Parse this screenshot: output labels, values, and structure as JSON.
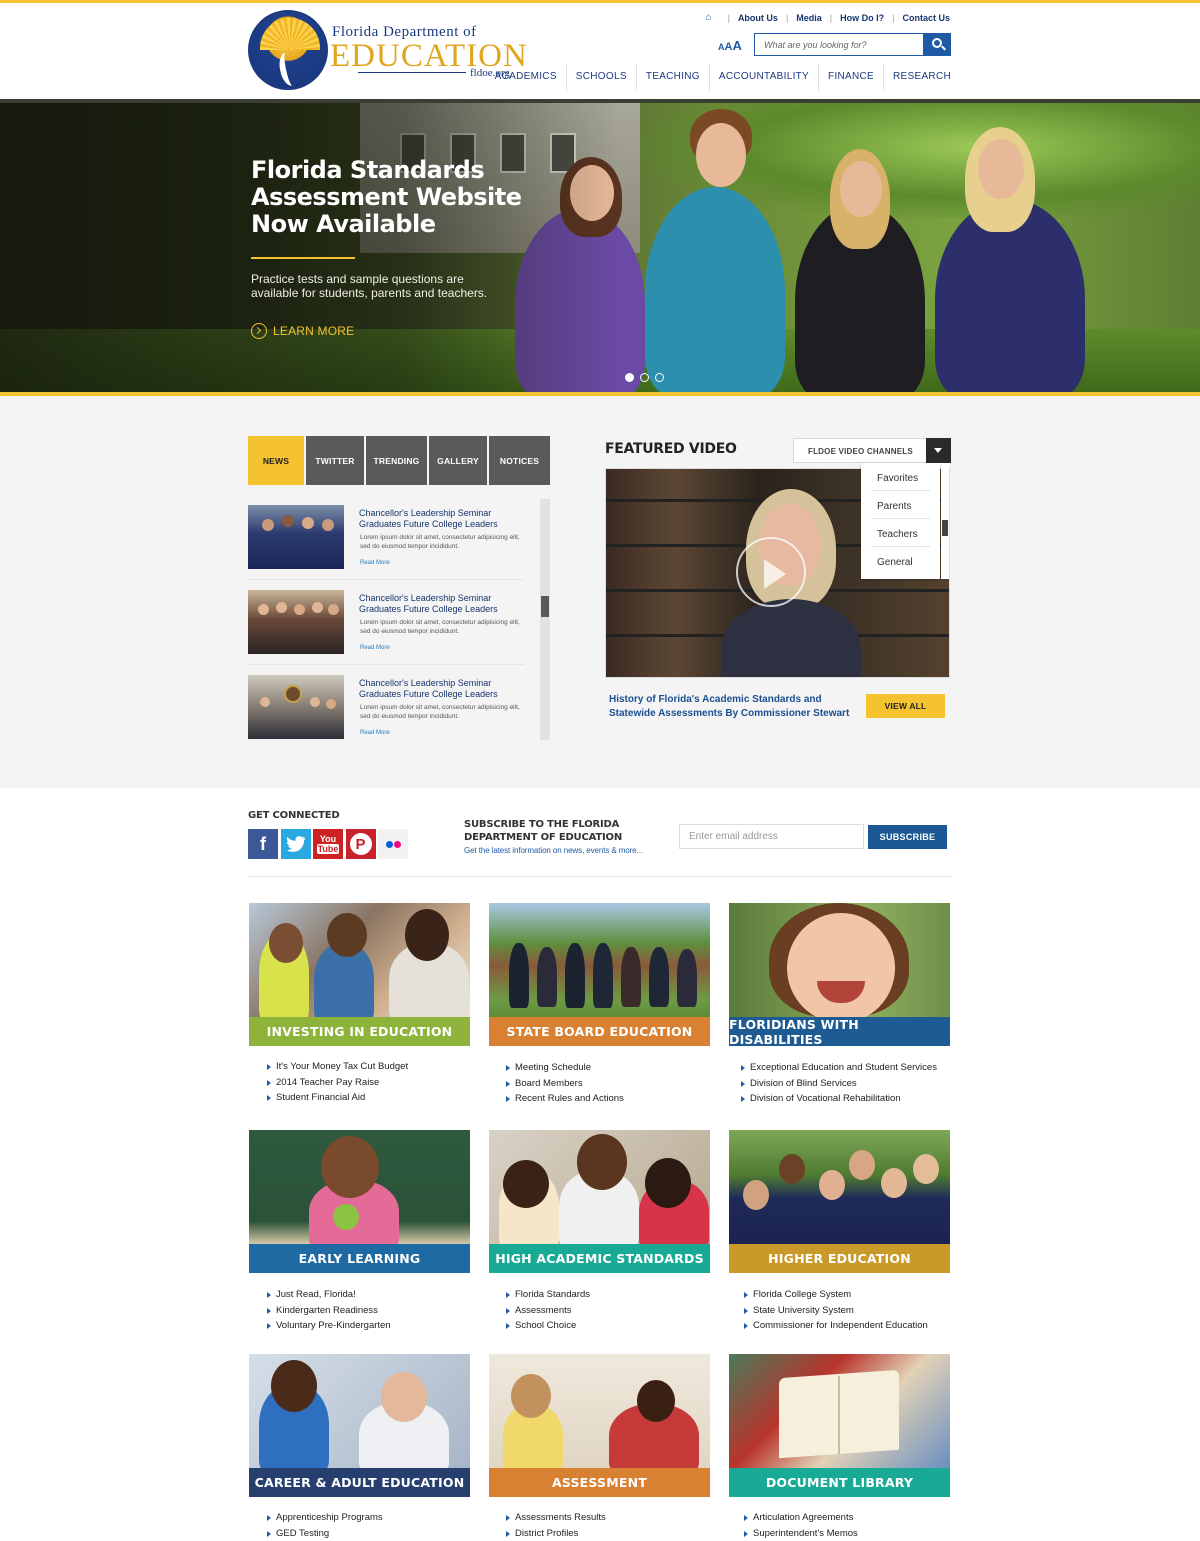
{
  "header": {
    "logo": {
      "line1": "Florida Department of",
      "line2": "EDUCATION",
      "url": "fldoe.org"
    },
    "utility_nav": [
      "About Us",
      "Media",
      "How Do I?",
      "Contact Us"
    ],
    "font_size_label": "AAA",
    "search_placeholder": "What are you looking for?",
    "main_nav": [
      "ACADEMICS",
      "SCHOOLS",
      "TEACHING",
      "ACCOUNTABILITY",
      "FINANCE",
      "RESEARCH"
    ]
  },
  "hero": {
    "title": "Florida Standards Assessment Website Now Available",
    "description": "Practice tests and sample questions are available for students, parents and teachers.",
    "cta": "LEARN MORE",
    "slides": 3,
    "active_slide": 1
  },
  "news": {
    "tabs": [
      "NEWS",
      "TWITTER",
      "TRENDING",
      "GALLERY",
      "NOTICES"
    ],
    "active_tab": "NEWS",
    "items": [
      {
        "title": "Chancellor's Leadership Seminar Graduates Future College Leaders",
        "body": "Lorem ipsum dolor sit amet, consectetur adipisicing elit, sed do eiusmod tempor incididunt.",
        "more": "Read More"
      },
      {
        "title": "Chancellor's Leadership Seminar Graduates Future College Leaders",
        "body": "Lorem ipsum dolor sit amet, consectetur adipisicing elit, sed do eiusmod tempor incididunt.",
        "more": "Read More"
      },
      {
        "title": "Chancellor's Leadership Seminar Graduates Future College Leaders",
        "body": "Lorem ipsum dolor sit amet, consectetur adipisicing elit, sed do eiusmod tempor incididunt.",
        "more": "Read More"
      }
    ]
  },
  "featured_video": {
    "title": "FEATURED VIDEO",
    "channels_label": "FLDOE VIDEO CHANNELS",
    "channel_options": [
      "Favorites",
      "Parents",
      "Teachers",
      "General"
    ],
    "caption": "History of Florida's Academic Standards and Statewide Assessments By Commissioner Stewart",
    "view_all": "VIEW ALL"
  },
  "connect": {
    "title": "GET CONNECTED",
    "social_icons": [
      "facebook-icon",
      "twitter-icon",
      "youtube-icon",
      "pinterest-icon",
      "flickr-icon"
    ],
    "subscribe_title": "SUBSCRIBE TO THE FLORIDA DEPARTMENT OF EDUCATION",
    "subscribe_sub": "Get the latest information on news, events & more...",
    "email_placeholder": "Enter email address",
    "subscribe_button": "SUBSCRIBE"
  },
  "cards": [
    {
      "title": "INVESTING IN EDUCATION",
      "color": "#8db33a",
      "links": [
        "It's Your Money Tax Cut Budget",
        "2014 Teacher Pay Raise",
        "Student Financial Aid"
      ]
    },
    {
      "title": "STATE BOARD EDUCATION",
      "color": "#d98132",
      "links": [
        "Meeting Schedule",
        "Board Members",
        "Recent Rules and Actions"
      ]
    },
    {
      "title": "FLORIDIANS WITH DISABILITIES",
      "color": "#1f5b93",
      "links": [
        "Exceptional Education and Student Services",
        "Division of Blind Services",
        "Division of Vocational Rehabilitation"
      ]
    },
    {
      "title": "EARLY LEARNING",
      "color": "#1f6aa3",
      "links": [
        "Just Read, Florida!",
        "Kindergarten Readiness",
        "Voluntary Pre-Kindergarten"
      ]
    },
    {
      "title": "HIGH ACADEMIC STANDARDS",
      "color": "#19aa96",
      "links": [
        "Florida Standards",
        "Assessments",
        "School Choice"
      ]
    },
    {
      "title": "HIGHER EDUCATION",
      "color": "#c99a2a",
      "links": [
        "Florida College System",
        "State University System",
        "Commissioner for Independent Education"
      ]
    },
    {
      "title": "CAREER & ADULT EDUCATION",
      "color": "#263f6e",
      "links": [
        "Apprenticeship Programs",
        "GED Testing"
      ]
    },
    {
      "title": "ASSESSMENT",
      "color": "#d98132",
      "links": [
        "Assessments Results",
        "District Profiles"
      ]
    },
    {
      "title": "DOCUMENT LIBRARY",
      "color": "#19aa96",
      "links": [
        "Articulation Agreements",
        "Superintendent's Memos"
      ]
    }
  ]
}
